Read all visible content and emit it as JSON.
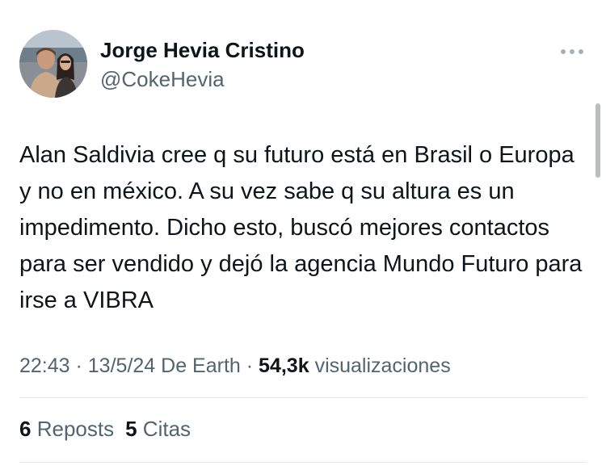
{
  "author": {
    "display_name": "Jorge Hevia Cristino",
    "handle": "@CokeHevia"
  },
  "tweet": {
    "text": "Alan Saldivia cree q su futuro está en Brasil o Europa y no en méxico. A su vez sabe q su altura es un impedimento. Dicho esto, buscó mejores contactos para ser vendido y dejó la agencia Mundo Futuro para irse a VIBRA"
  },
  "meta": {
    "time": "22:43",
    "separator": " · ",
    "date": "13/5/24",
    "source": "De Earth",
    "views_count": "54,3k",
    "views_label": "visualizaciones"
  },
  "engagement": {
    "reposts_count": "6",
    "reposts_label": "Reposts",
    "quotes_count": "5",
    "quotes_label": "Citas"
  },
  "icons": {
    "more": "more-horizontal-icon"
  },
  "colors": {
    "text_primary": "#0f1419",
    "text_secondary": "#536471",
    "divider": "#e3e7ea"
  }
}
